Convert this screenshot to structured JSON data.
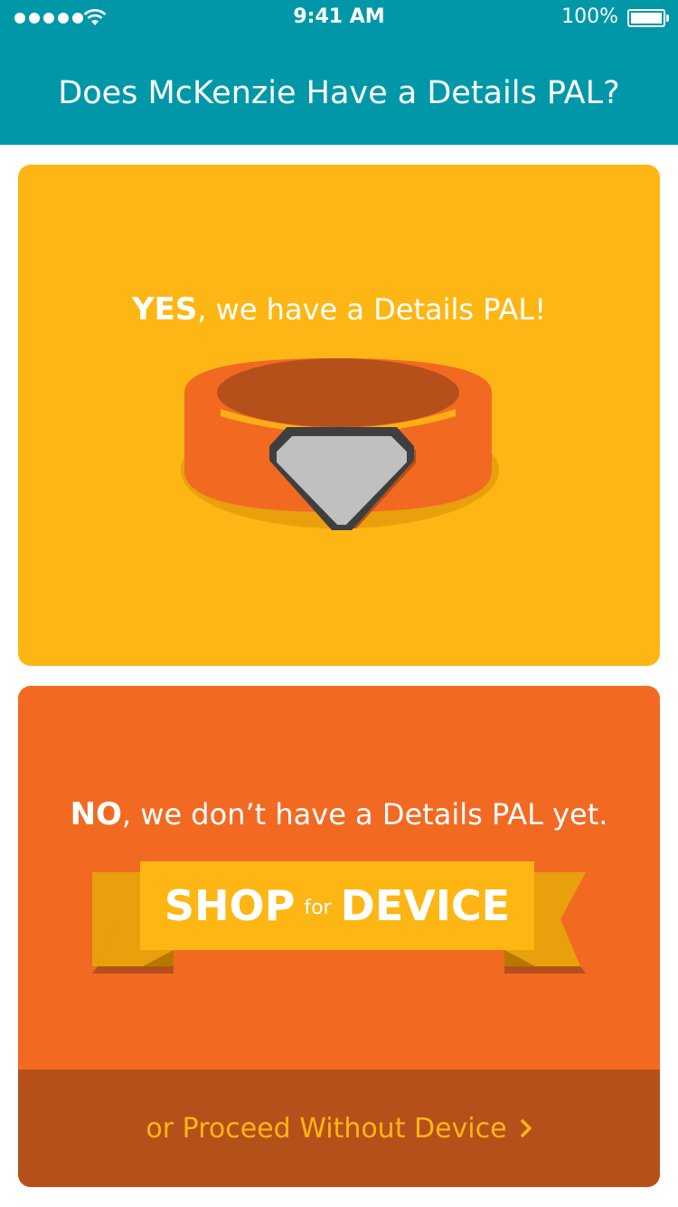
{
  "status_bar": {
    "time": "9:41 AM",
    "battery": "100%"
  },
  "header": {
    "title": "Does McKenzie Have a Details PAL?"
  },
  "yes_card": {
    "strong": "YES",
    "rest": ", we have a Details PAL!"
  },
  "no_card": {
    "strong": "NO",
    "rest": ", we don’t have a Details PAL yet.",
    "shop_word": "SHOP",
    "for_word": "for",
    "device_word": "DEVICE",
    "proceed_label": "or Proceed Without Device"
  },
  "colors": {
    "header": "#0098a8",
    "yes_card": "#fdb614",
    "no_card": "#f26a22",
    "proceed_bar": "#b5501b",
    "proceed_text": "#fdb614"
  }
}
